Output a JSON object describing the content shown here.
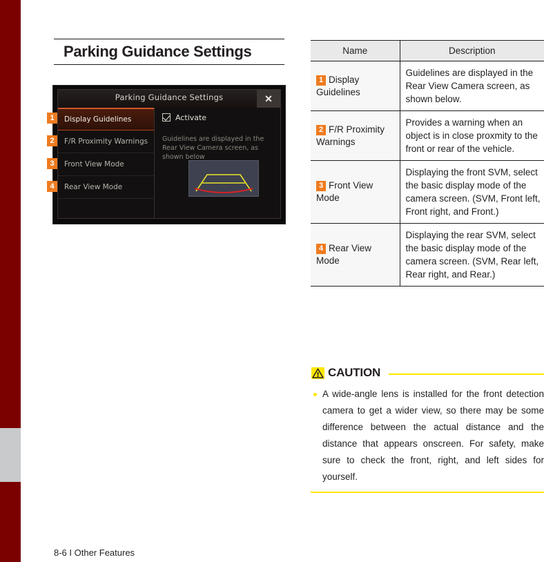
{
  "page": {
    "section_title": "Parking Guidance Settings",
    "footer": "8-6 I Other Features"
  },
  "device_screenshot": {
    "title": "Parking Guidance Settings",
    "close_icon": "close-icon",
    "menu_items": [
      {
        "badge": "1",
        "label": "Display Guidelines",
        "selected": true
      },
      {
        "badge": "2",
        "label": "F/R Proximity Warnings",
        "selected": false
      },
      {
        "badge": "3",
        "label": "Front View Mode",
        "selected": false
      },
      {
        "badge": "4",
        "label": "Rear View Mode",
        "selected": false
      }
    ],
    "checkbox_label": "Activate",
    "checkbox_checked": true,
    "description": "Guidelines are displayed in the Rear View Camera screen, as shown below",
    "preview_alt": "rear-view-camera-guideline-preview"
  },
  "table": {
    "headers": [
      "Name",
      "Description"
    ],
    "rows": [
      {
        "badge": "1",
        "name": "Display Guidelines",
        "description": "Guidelines are displayed in the Rear View Camera screen, as shown below."
      },
      {
        "badge": "2",
        "name": "F/R Proximity Warnings",
        "description": "Provides a warning when an object is in close prox­mity to the front or rear of the vehicle."
      },
      {
        "badge": "3",
        "name": "Front View Mode",
        "description": "Displaying the front SVM, select the basic display mode of the camera screen. (SVM, Front left, Front right, and Front.)"
      },
      {
        "badge": "4",
        "name": "Rear View Mode",
        "description": "Displaying the rear SVM, select the basic display mode of the camera screen. (SVM, Rear left, Rear right, and Rear.)"
      }
    ]
  },
  "caution": {
    "label": "CAUTION",
    "icon": "warning-triangle-icon",
    "text": "A wide-angle lens is installed for the front detection camera to get a wider view, so there may be some difference between the actual distance and the distance that appears onscreen. For safety, make sure to check the front, right, and left sides for yourself."
  },
  "colors": {
    "edge_bar": "#7b0000",
    "edge_marker": "#c8cacc",
    "badge_orange": "#ef7b1f",
    "caution_yellow": "#ffe600",
    "ink": "#231f20",
    "table_header_bg": "#e9e9e9",
    "table_name_bg": "#f7f7f7"
  }
}
